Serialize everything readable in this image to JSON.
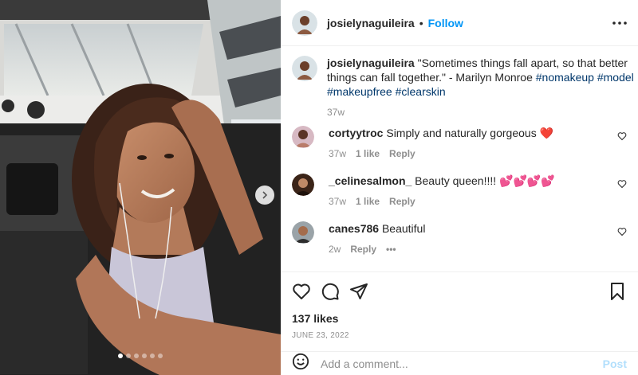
{
  "post": {
    "username": "josielynaguileira",
    "follow_label": "Follow",
    "separator": "•",
    "caption": {
      "username": "josielynaguileira",
      "text": "\"Sometimes things fall apart, so that better things can fall together.\" - Marilyn Monroe",
      "hashtags": [
        "#nomakeup",
        "#model",
        "#makeupfree",
        "#clearskin"
      ],
      "age": "37w"
    },
    "likes": "137 likes",
    "date": "JUNE 23, 2022",
    "carousel": {
      "count": 6,
      "active_index": 0
    }
  },
  "comments": [
    {
      "username": "cortyytroc",
      "text": "Simply and naturally gorgeous ❤️",
      "age": "37w",
      "likes": "1 like",
      "reply": "Reply"
    },
    {
      "username": "_celinesalmon_",
      "text": "Beauty queen!!!! 💕💕💕💕",
      "age": "37w",
      "likes": "1 like",
      "reply": "Reply"
    },
    {
      "username": "canes786",
      "text": "Beautiful",
      "age": "2w",
      "reply": "Reply",
      "more": "•••"
    }
  ],
  "add_comment": {
    "placeholder": "Add a comment...",
    "post_label": "Post"
  },
  "icons": {
    "more": "more-options-icon",
    "like": "heart-icon",
    "comment": "comment-icon",
    "share": "share-icon",
    "save": "bookmark-icon",
    "emoji": "emoji-icon",
    "next": "chevron-right-icon"
  },
  "colors": {
    "accent": "#0095f6",
    "text": "#262626",
    "muted": "#8e8e8e",
    "hashtag": "#00376b",
    "post_disabled": "#b2dffc"
  }
}
